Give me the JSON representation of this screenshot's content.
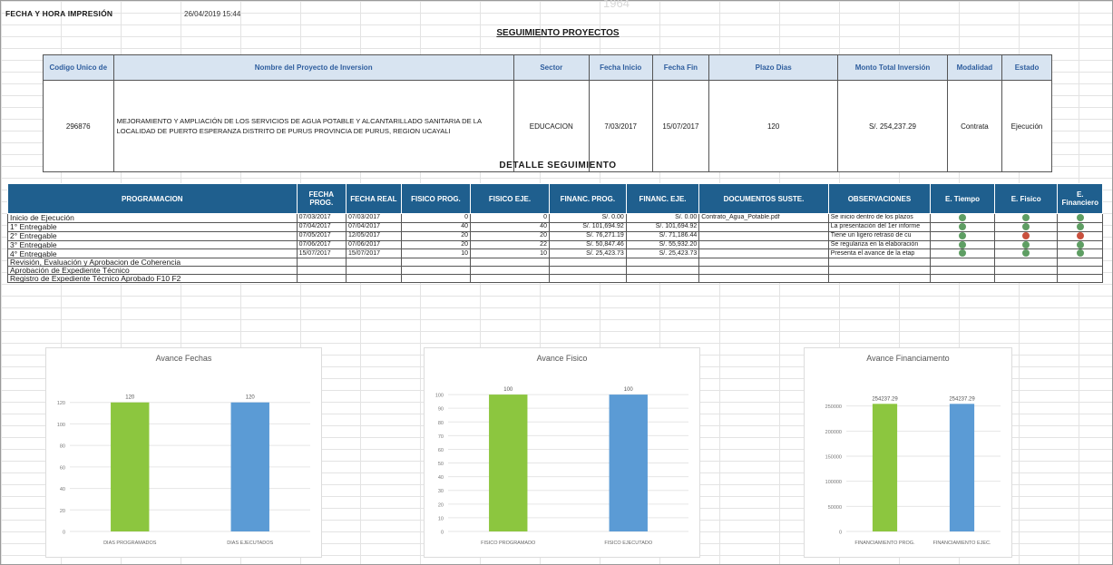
{
  "watermark": "1964",
  "header": {
    "print_label": "FECHA Y HORA IMPRESIÓN",
    "print_value": "26/04/2019 15:44"
  },
  "project_section_title": "SEGUIMIENTO PROYECTOS",
  "project_table": {
    "headers": [
      "Codigo Unico de",
      "Nombre del Proyecto de Inversion",
      "Sector",
      "Fecha Inicio",
      "Fecha Fin",
      "Plazo Dias",
      "Monto Total Inversión",
      "Modalidad",
      "Estado"
    ],
    "row": [
      "296876",
      "MEJORAMIENTO Y AMPLIACIÓN DE LOS SERVICIOS DE AGUA POTABLE Y ALCANTARILLADO SANITARIA DE LA LOCALIDAD DE PUERTO ESPERANZA DISTRITO DE PURUS PROVINCIA DE PURUS, REGION UCAYALI",
      "EDUCACION",
      "7/03/2017",
      "15/07/2017",
      "120",
      "S/. 254,237.29",
      "Contrata",
      "Ejecución"
    ]
  },
  "detail_section_title": "DETALLE SEGUIMIENTO",
  "detail_table": {
    "headers": [
      "PROGRAMACION",
      "FECHA PROG.",
      "FECHA REAL",
      "FISICO PROG.",
      "FISICO EJE.",
      "FINANC. PROG.",
      "FINANC. EJE.",
      "DOCUMENTOS SUSTE.",
      "OBSERVACIONES",
      "E. Tiempo",
      "E. Fisico",
      "E. Financiero"
    ],
    "rows": [
      {
        "label": "Inicio de Ejecución",
        "fecha_prog": "07/03/2017",
        "fecha_real": "07/03/2017",
        "fisico_prog": "0",
        "fisico_eje": "0",
        "financ_prog": "S/. 0.00",
        "financ_eje": "S/. 0.00",
        "docs": "Contrato_Agua_Potable.pdf",
        "obs": "Se inicio dentro de los plazos",
        "dots": [
          "#5e9e63",
          "#5e9e63",
          "#5e9e63"
        ]
      },
      {
        "label": "1° Entregable",
        "fecha_prog": "07/04/2017",
        "fecha_real": "07/04/2017",
        "fisico_prog": "40",
        "fisico_eje": "40",
        "financ_prog": "S/. 101,694.92",
        "financ_eje": "S/. 101,694.92",
        "docs": "",
        "obs": "La presentación del 1er informe",
        "dots": [
          "#5e9e63",
          "#5e9e63",
          "#5e9e63"
        ]
      },
      {
        "label": "2° Entregable",
        "fecha_prog": "07/05/2017",
        "fecha_real": "12/05/2017",
        "fisico_prog": "20",
        "fisico_eje": "20",
        "financ_prog": "S/. 76,271.19",
        "financ_eje": "S/. 71,186.44",
        "docs": "",
        "obs": "Tiene un ligero retraso de cu",
        "dots": [
          "#5e9e63",
          "#c9503d",
          "#c9503d"
        ]
      },
      {
        "label": "3° Entregable",
        "fecha_prog": "07/06/2017",
        "fecha_real": "07/06/2017",
        "fisico_prog": "20",
        "fisico_eje": "22",
        "financ_prog": "S/. 50,847.46",
        "financ_eje": "S/. 55,932.20",
        "docs": "",
        "obs": "Se regulariza en la elaboración",
        "dots": [
          "#5e9e63",
          "#5e9e63",
          "#5e9e63"
        ]
      },
      {
        "label": "4° Entregable",
        "fecha_prog": "15/07/2017",
        "fecha_real": "15/07/2017",
        "fisico_prog": "10",
        "fisico_eje": "10",
        "financ_prog": "S/. 25,423.73",
        "financ_eje": "S/. 25,423.73",
        "docs": "",
        "obs": "Presenta el avance de la etap",
        "dots": [
          "#5e9e63",
          "#5e9e63",
          "#5e9e63"
        ]
      },
      {
        "label": "Revisión, Evaluación y Aprobacion de Coherencia",
        "fecha_prog": "",
        "fecha_real": "",
        "fisico_prog": "",
        "fisico_eje": "",
        "financ_prog": "",
        "financ_eje": "",
        "docs": "",
        "obs": "",
        "dots": []
      },
      {
        "label": "Aprobación de Expediente Técnico",
        "fecha_prog": "",
        "fecha_real": "",
        "fisico_prog": "",
        "fisico_eje": "",
        "financ_prog": "",
        "financ_eje": "",
        "docs": "",
        "obs": "",
        "dots": []
      },
      {
        "label": "Registro de Expediente Técnico Aprobado F10 F2",
        "fecha_prog": "",
        "fecha_real": "",
        "fisico_prog": "",
        "fisico_eje": "",
        "financ_prog": "",
        "financ_eje": "",
        "docs": "",
        "obs": "",
        "dots": []
      }
    ]
  },
  "chart_data": [
    {
      "type": "bar",
      "title": "Avance Fechas",
      "categories": [
        "DIAS PROGRAMADOS",
        "DIAS EJECUTADOS"
      ],
      "values": [
        120,
        120
      ],
      "colors": [
        "#8cc63f",
        "#5b9bd5"
      ],
      "ylim": [
        0,
        140
      ],
      "yticks": [
        0,
        20,
        40,
        60,
        80,
        100,
        120
      ],
      "data_labels": [
        "120",
        "120"
      ]
    },
    {
      "type": "bar",
      "title": "Avance Fisico",
      "categories": [
        "FISICO PROGRAMADO",
        "FISICO EJECUTADO"
      ],
      "values": [
        100,
        100
      ],
      "colors": [
        "#8cc63f",
        "#5b9bd5"
      ],
      "ylim": [
        0,
        110
      ],
      "yticks": [
        0,
        10,
        20,
        30,
        40,
        50,
        60,
        70,
        80,
        90,
        100
      ],
      "data_labels": [
        "100",
        "100"
      ]
    },
    {
      "type": "bar",
      "title": "Avance Financiamento",
      "categories": [
        "FINANCIAMIENTO PROG.",
        "FINANCIAMIENTO EJEC."
      ],
      "values": [
        254237.29,
        254237.29
      ],
      "colors": [
        "#8cc63f",
        "#5b9bd5"
      ],
      "ylim": [
        0,
        300000
      ],
      "yticks": [
        0,
        50000,
        100000,
        150000,
        200000,
        250000
      ],
      "data_labels": [
        "254237.29",
        "254237.29"
      ]
    }
  ]
}
